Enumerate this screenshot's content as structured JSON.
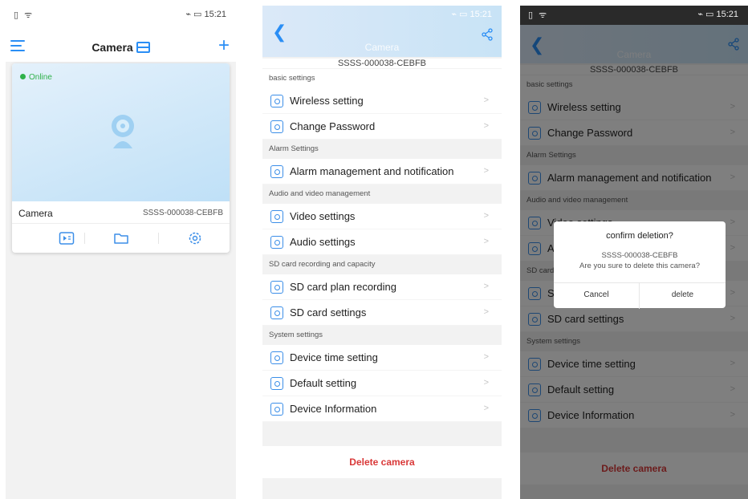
{
  "phone1": {
    "status_left": "▯ ᯤ",
    "status_right": "⌁ ▭ 15:21",
    "title": "Camera",
    "card": {
      "status": "Online",
      "name": "Camera",
      "device_id": "SSSS-000038-CEBFB"
    },
    "colors": {
      "accent": "#2a8ef5",
      "online": "#2fb14a"
    },
    "icons": [
      "menu-icon",
      "layout-icon",
      "plus-icon",
      "camera-icon",
      "playback-icon",
      "folder-icon",
      "gear-icon"
    ]
  },
  "settings": {
    "status_right": "⌁ ▭ 15:21",
    "title": "Camera",
    "device_id": "SSSS-000038-CEBFB",
    "groups": [
      {
        "label": "basic settings",
        "items": [
          "Wireless setting",
          "Change Password"
        ]
      },
      {
        "label": "Alarm Settings",
        "items": [
          "Alarm management and notification"
        ]
      },
      {
        "label": "Audio and video management",
        "items": [
          "Video settings",
          "Audio settings"
        ]
      },
      {
        "label": "SD card recording and capacity",
        "items": [
          "SD card plan recording",
          "SD card settings"
        ]
      },
      {
        "label": "System settings",
        "items": [
          "Device time setting",
          "Default setting",
          "Device Information"
        ]
      }
    ],
    "chevron": ">",
    "delete_label": "Delete camera",
    "colors": {
      "delete": "#d93838",
      "icon": "#3b8ee8"
    }
  },
  "phone3": {
    "status_left": "▯ ᯤ",
    "status_right": "⌁ ▭ 15:21",
    "dialog": {
      "title": "confirm deletion?",
      "device_id": "SSSS-000038-CEBFB",
      "message": "Are you sure to delete this camera?",
      "cancel": "Cancel",
      "delete": "delete"
    }
  }
}
